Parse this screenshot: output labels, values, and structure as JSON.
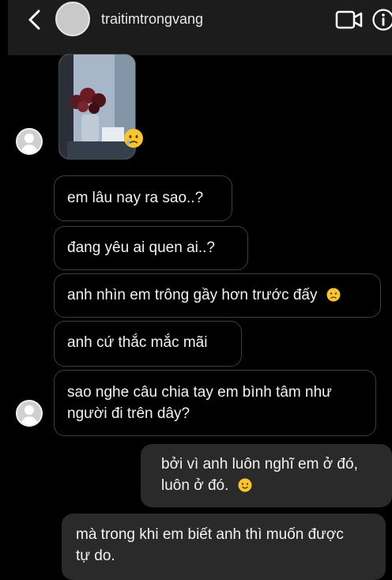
{
  "header": {
    "username": "traitimtrongvang",
    "icons": {
      "back": "chevron-left-icon",
      "video": "video-camera-icon",
      "info": "info-icon"
    }
  },
  "messages": {
    "m1": "em lâu nay ra sao..?",
    "m2": "đang yêu ai quen ai..?",
    "m3": "anh nhìn em trông gầy hơn trước đấy",
    "m4": "anh cứ thắc mắc mãi",
    "m5_line1": "sao nghe câu chia tay em bình tâm như",
    "m5_line2": "người đi trên dây?",
    "m6_line1": "bởi vì anh luôn nghĩ em ở đó,",
    "m6_line2": "luôn ở đó.",
    "m7_line1": "mà trong khi em biết anh thì muốn được",
    "m7_line2": "tự do."
  },
  "emojis": {
    "photo_reaction": "crying-face-emoji",
    "m3": "frowning-face-emoji",
    "m6": "smiling-face-emoji"
  },
  "colors": {
    "background": "#000000",
    "header": "#1c1c1c",
    "received_border": "#3e3e3e",
    "sent_bubble": "#2a2a2a"
  }
}
